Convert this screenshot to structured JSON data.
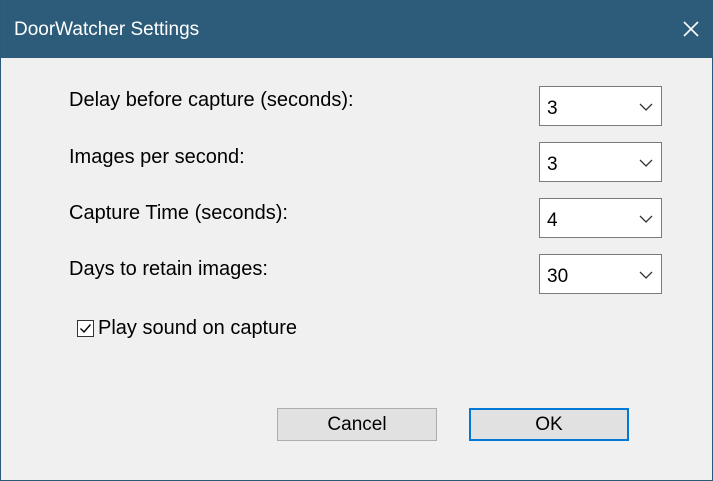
{
  "window": {
    "title": "DoorWatcher Settings",
    "close_icon": "close-icon"
  },
  "settings": [
    {
      "label": "Delay before capture (seconds):",
      "value": "3"
    },
    {
      "label": "Images per second:",
      "value": "3"
    },
    {
      "label": "Capture Time (seconds):",
      "value": "4"
    },
    {
      "label": "Days to retain images:",
      "value": "30"
    }
  ],
  "play_sound": {
    "label": "Play sound on capture",
    "checked": true
  },
  "buttons": {
    "cancel_label": "Cancel",
    "ok_label": "OK"
  },
  "colors": {
    "titlebar": "#2d5c7b",
    "accent": "#0078d7",
    "background": "#f0f0f0"
  }
}
